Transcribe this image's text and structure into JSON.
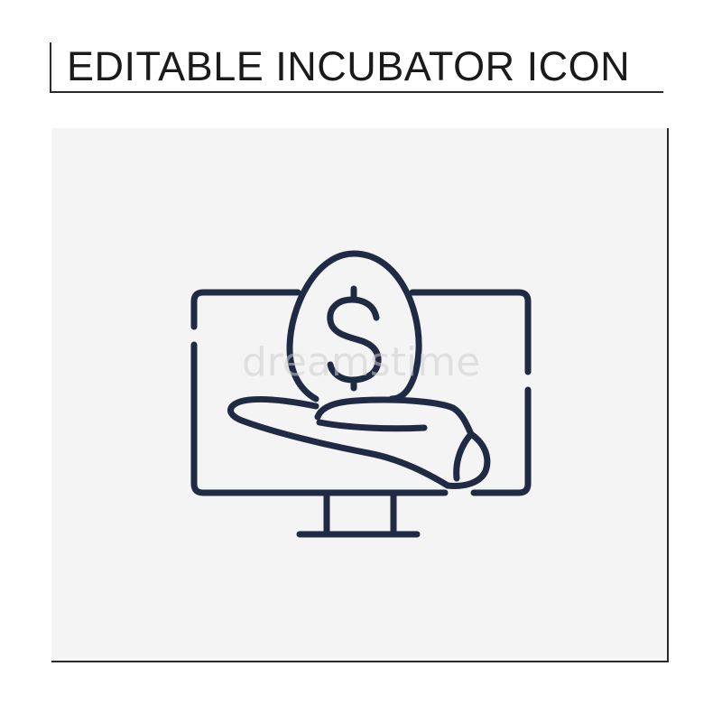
{
  "title": "EDITABLE INCUBATOR ICON",
  "icon": {
    "name": "incubator-icon",
    "parts": [
      "monitor-icon",
      "money-egg-icon",
      "dollar-sign-icon",
      "open-hand-icon"
    ],
    "stroke_color": "#1f2a44",
    "panel_color": "#f4f4f4"
  },
  "watermark": "dreamstime"
}
